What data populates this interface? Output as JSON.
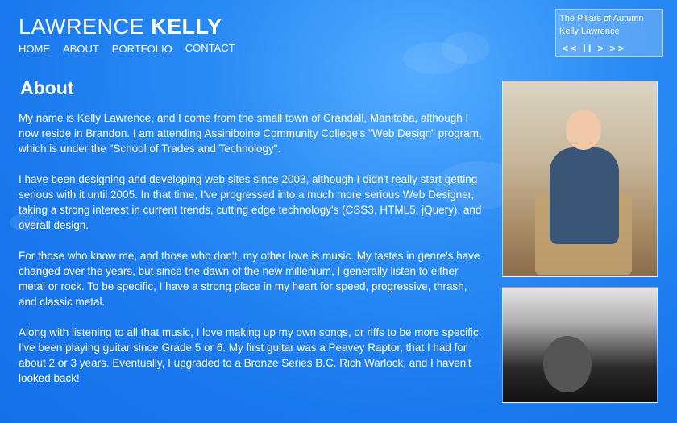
{
  "header": {
    "logo_first": "LAWRENCE",
    "logo_last": "KELLY"
  },
  "nav": {
    "items": [
      {
        "label": "HOME"
      },
      {
        "label": "ABOUT"
      },
      {
        "label": "PORTFOLIO"
      },
      {
        "label": "CONTACT"
      }
    ]
  },
  "player": {
    "track_title": "The Pillars of Autumn",
    "artist": "Kelly  Lawrence",
    "controls": {
      "previous": "< <",
      "pause": "I I",
      "play": ">",
      "next": "> >"
    }
  },
  "page": {
    "title": "About",
    "paragraphs": [
      "My name is Kelly Lawrence, and I come from the small town of Crandall, Manitoba, although I now reside in Brandon. I am attending Assiniboine Community College's \"Web Design\" program, which is under the \"School of Trades and Technology\".",
      "I have been designing and developing web sites since 2003, although I didn't really start getting serious with it until 2005. In that time, I've progressed into a much more serious Web Designer, taking a strong interest in current trends,  cutting edge technology's (CSS3, HTML5, jQuery), and overall design.",
      "For those who know me, and those who don't, my other love is music. My tastes in genre's have changed over the years, but since the dawn of the new millenium, I generally listen to either metal or rock. To be specific, I have a strong place in my heart for speed, progressive, thrash, and classic metal.",
      "Along with listening to all that music, I love making up my own songs, or riffs to be more specific. I've been playing guitar since Grade 5 or 6. My first guitar was a Peavey Raptor, that I had for about 2 or 3 years. Eventually, I upgraded to a Bronze Series B.C. Rich Warlock, and I haven't looked back!"
    ]
  },
  "colors": {
    "background": "#1a78ee",
    "text": "#ffffff"
  }
}
